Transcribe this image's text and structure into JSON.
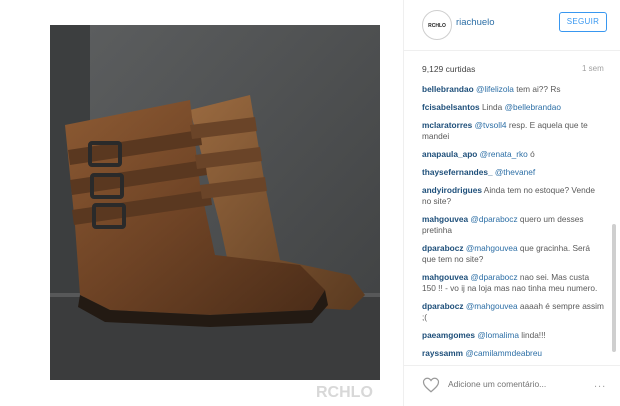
{
  "watermark": "RCHLO",
  "header": {
    "avatar_text": "RCHLO",
    "username": "riachuelo",
    "follow_label": "SEGUIR"
  },
  "stats": {
    "likes": "9,129 curtidas",
    "time": "1 sem"
  },
  "comments": [
    {
      "user": "bellebrandao",
      "mention": "@lifelizola",
      "text": "tem ai?? Rs"
    },
    {
      "user": "fcisabelsantos",
      "text": "Linda",
      "mention": "@bellebrandao",
      "after": ""
    },
    {
      "user": "mclaratorres",
      "mention": "@tvsoll4",
      "text": "resp. E aquela que te mandei"
    },
    {
      "user": "anapaula_apo",
      "mention": "@renata_rko",
      "text": "ó"
    },
    {
      "user": "thaysefernandes_",
      "mention": "@thevanef",
      "text": ""
    },
    {
      "user": "andyirodrigues",
      "text": "Ainda tem no estoque? Vende no site?"
    },
    {
      "user": "mahgouvea",
      "mention": "@dparabocz",
      "text": "quero um desses pretinha"
    },
    {
      "user": "dparabocz",
      "mention": "@mahgouvea",
      "text": "que gracinha. Será que tem no site?"
    },
    {
      "user": "mahgouvea",
      "mention": "@dparabocz",
      "text": "nao sei. Mas custa 150 !! - vo ij na loja mas nao tinha meu numero."
    },
    {
      "user": "dparabocz",
      "mention": "@mahgouvea",
      "text": "aaaah é sempre assim ;("
    },
    {
      "user": "paeamgomes",
      "mention": "@lomalima",
      "text": "linda!!!"
    },
    {
      "user": "rayssamm",
      "mention": "@camilammdeabreu",
      "text": ""
    }
  ],
  "footer": {
    "comment_placeholder": "Adicione um comentário...",
    "more": "..."
  },
  "colors": {
    "link": "#2d6fa6",
    "follow": "#3897f0"
  }
}
